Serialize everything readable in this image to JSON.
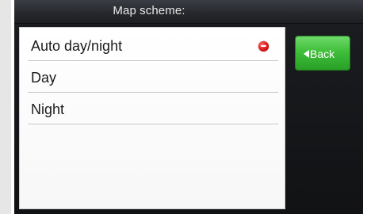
{
  "header": {
    "title": "Map scheme:"
  },
  "list": {
    "items": [
      {
        "label": "Auto day/night",
        "selected": true
      },
      {
        "label": "Day",
        "selected": false
      },
      {
        "label": "Night",
        "selected": false
      }
    ]
  },
  "back_button": {
    "label": "Back",
    "icon": "left-arrow-icon"
  },
  "colors": {
    "accent": "#3fbf3a",
    "selected_indicator": "#d81818",
    "background": "#151619"
  }
}
